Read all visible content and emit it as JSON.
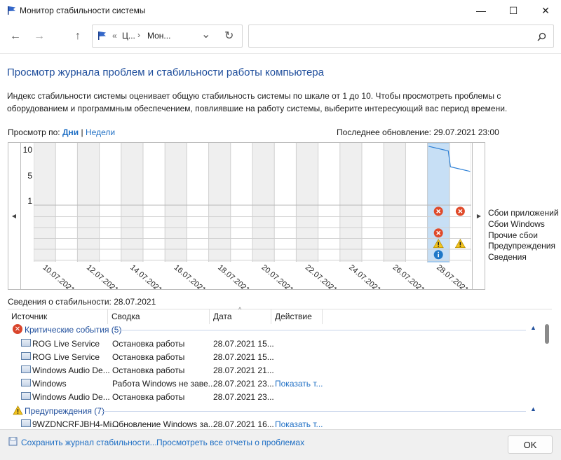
{
  "window": {
    "title": "Монитор стабильности системы",
    "controls": {
      "minimize": "—",
      "maximize": "☐",
      "close": "✕"
    }
  },
  "nav": {
    "back": "←",
    "forward": "→",
    "up": "↑",
    "breadcrumb": [
      "Ц...",
      "Мон..."
    ],
    "chevron": "›",
    "back_crumb": "«",
    "dropdown": "⌄",
    "refresh": "↻",
    "search_placeholder": ""
  },
  "page": {
    "heading": "Просмотр журнала проблем и стабильности работы компьютера",
    "description": "Индекс стабильности системы оценивает общую стабильность системы по шкале от 1 до 10. Чтобы просмотреть проблемы с оборудованием и программным обеспечением, повлиявшие на работу системы, выберите интересующий вас период времени.",
    "view_by_label": "Просмотр по:",
    "view_days": "Дни",
    "view_sep": "|",
    "view_weeks": "Недели",
    "last_update": "Последнее обновление: 29.07.2021 23:00"
  },
  "chart_data": {
    "type": "line",
    "y_ticks": [
      "10",
      "5",
      "1"
    ],
    "ylim": [
      1,
      10
    ],
    "dates": [
      "10.07.2021",
      "12.07.2021",
      "14.07.2021",
      "16.07.2021",
      "18.07.2021",
      "20.07.2021",
      "22.07.2021",
      "24.07.2021",
      "26.07.2021",
      "28.07.2021"
    ],
    "selected_date": "28.07.2021",
    "series": [
      {
        "x": [
          "28.07.2021",
          "28.07.2021",
          "29.07.2021",
          "29.07.2021"
        ],
        "values": [
          9.9,
          9.2,
          6.8,
          6.1
        ]
      }
    ],
    "legend": [
      "Сбои приложений",
      "Сбои Windows",
      "Прочие сбои",
      "Предупреждения",
      "Сведения"
    ],
    "events": [
      {
        "date": "28.07.2021",
        "row": "Сбои приложений",
        "kind": "critical"
      },
      {
        "date": "29.07.2021",
        "row": "Сбои приложений",
        "kind": "critical"
      },
      {
        "date": "28.07.2021",
        "row": "Прочие сбои",
        "kind": "critical"
      },
      {
        "date": "28.07.2021",
        "row": "Предупреждения",
        "kind": "warning"
      },
      {
        "date": "29.07.2021",
        "row": "Предупреждения",
        "kind": "warning"
      },
      {
        "date": "28.07.2021",
        "row": "Сведения",
        "kind": "info"
      }
    ],
    "colors": {
      "line": "#2b7fd6",
      "critical": "#e04a2a",
      "warning": "#f3c31d",
      "info": "#1e78c8",
      "selection": "#c7dff5",
      "weekend": "#efefef"
    }
  },
  "details": {
    "title": "Сведения о стабильности: 28.07.2021",
    "columns": [
      "Источник",
      "Сводка",
      "Дата",
      "Действие"
    ],
    "groups": [
      {
        "label": "Критические события (5)",
        "icon": "error-icon",
        "rows": [
          {
            "source": "ROG Live Service",
            "summary": "Остановка работы",
            "date": "28.07.2021 15...",
            "action": ""
          },
          {
            "source": "ROG Live Service",
            "summary": "Остановка работы",
            "date": "28.07.2021 15...",
            "action": ""
          },
          {
            "source": "Windows Audio De...",
            "summary": "Остановка работы",
            "date": "28.07.2021 21...",
            "action": ""
          },
          {
            "source": "Windows",
            "summary": "Работа Windows не заве...",
            "date": "28.07.2021 23...",
            "action": "Показать т..."
          },
          {
            "source": "Windows Audio De...",
            "summary": "Остановка работы",
            "date": "28.07.2021 23...",
            "action": ""
          }
        ]
      },
      {
        "label": "Предупреждения (7)",
        "icon": "warning-icon",
        "rows": [
          {
            "source": "9WZDNCRFJBH4-Mi...",
            "summary": "Обновление Windows за...",
            "date": "28.07.2021 16...",
            "action": "Показать т..."
          }
        ]
      }
    ],
    "collapse_glyph": "▲"
  },
  "footer": {
    "save": "Сохранить журнал стабильности...",
    "all_reports": "Просмотреть все отчеты о проблемах",
    "ok": "OK"
  }
}
